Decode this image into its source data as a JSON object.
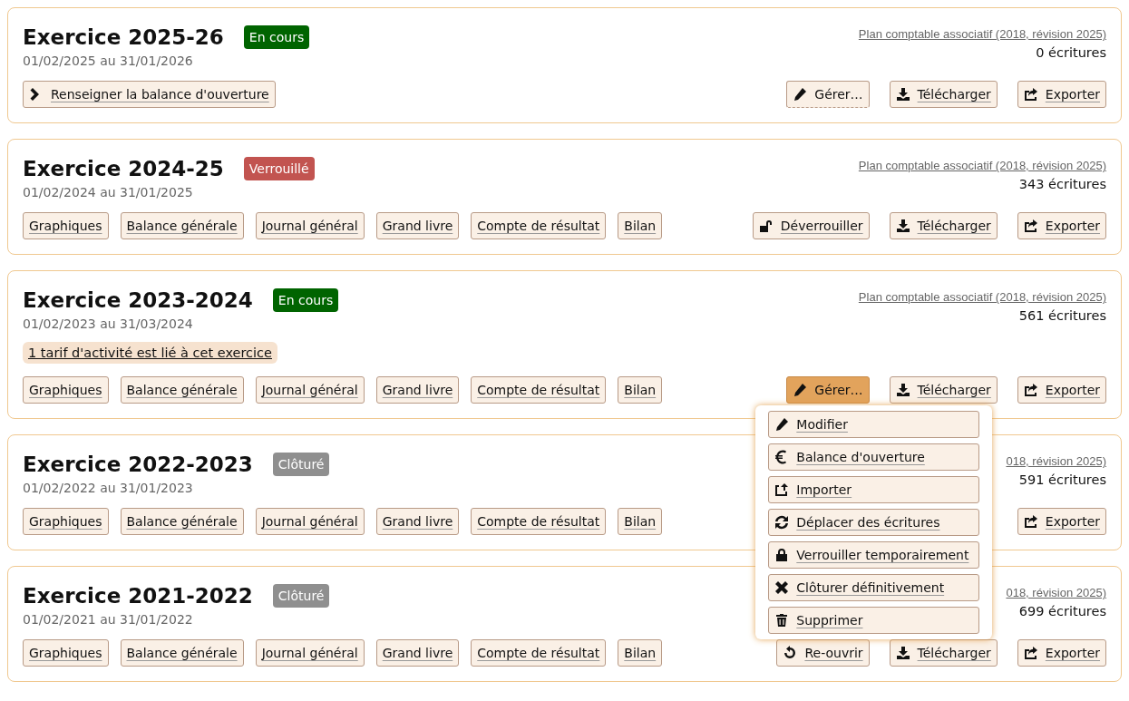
{
  "exercises": [
    {
      "title": "Exercice 2025-26",
      "status": {
        "label": "En cours",
        "kind": "open"
      },
      "dates": "01/02/2025 au 31/01/2026",
      "chart_of_accounts": "Plan comptable associatif (2018, révision 2025)",
      "entries": "0 écritures",
      "links": [
        {
          "label": "Renseigner la balance d'ouverture",
          "kind": "next"
        }
      ],
      "actions": [
        {
          "label": "Gérer…",
          "kind": "manage",
          "expanded": false
        },
        {
          "label": "Télécharger",
          "kind": "download"
        },
        {
          "label": "Exporter",
          "kind": "export"
        }
      ]
    },
    {
      "title": "Exercice 2024-25",
      "status": {
        "label": "Verrouillé",
        "kind": "locked"
      },
      "dates": "01/02/2024 au 31/01/2025",
      "chart_of_accounts": "Plan comptable associatif (2018, révision 2025)",
      "entries": "343 écritures",
      "links": [
        {
          "label": "Graphiques",
          "kind": "plain"
        },
        {
          "label": "Balance générale",
          "kind": "plain"
        },
        {
          "label": "Journal général",
          "kind": "plain"
        },
        {
          "label": "Grand livre",
          "kind": "plain"
        },
        {
          "label": "Compte de résultat",
          "kind": "plain"
        },
        {
          "label": "Bilan",
          "kind": "plain"
        }
      ],
      "actions": [
        {
          "label": "Déverrouiller",
          "kind": "unlock"
        },
        {
          "label": "Télécharger",
          "kind": "download"
        },
        {
          "label": "Exporter",
          "kind": "export"
        }
      ]
    },
    {
      "title": "Exercice 2023-2024",
      "status": {
        "label": "En cours",
        "kind": "open"
      },
      "dates": "01/02/2023 au 31/03/2024",
      "chart_of_accounts": "Plan comptable associatif (2018, révision 2025)",
      "entries": "561 écritures",
      "notice": "1 tarif d'activité est lié à cet exercice",
      "links": [
        {
          "label": "Graphiques",
          "kind": "plain"
        },
        {
          "label": "Balance générale",
          "kind": "plain"
        },
        {
          "label": "Journal général",
          "kind": "plain"
        },
        {
          "label": "Grand livre",
          "kind": "plain"
        },
        {
          "label": "Compte de résultat",
          "kind": "plain"
        },
        {
          "label": "Bilan",
          "kind": "plain"
        }
      ],
      "actions": [
        {
          "label": "Gérer…",
          "kind": "manage",
          "expanded": true,
          "menu": [
            {
              "label": "Modifier",
              "kind": "edit"
            },
            {
              "label": "Balance d'ouverture",
              "kind": "euro"
            },
            {
              "label": "Importer",
              "kind": "import"
            },
            {
              "label": "Déplacer des écritures",
              "kind": "move"
            },
            {
              "label": "Verrouiller temporairement",
              "kind": "lock"
            },
            {
              "label": "Clôturer définitivement",
              "kind": "close"
            },
            {
              "label": "Supprimer",
              "kind": "delete"
            }
          ]
        },
        {
          "label": "Télécharger",
          "kind": "download"
        },
        {
          "label": "Exporter",
          "kind": "export"
        }
      ]
    },
    {
      "title": "Exercice 2022-2023",
      "status": {
        "label": "Clôturé",
        "kind": "closed"
      },
      "dates": "01/02/2022 au 31/01/2023",
      "chart_of_accounts": "018, révision 2025)",
      "entries": "591 écritures",
      "links": [
        {
          "label": "Graphiques",
          "kind": "plain"
        },
        {
          "label": "Balance générale",
          "kind": "plain"
        },
        {
          "label": "Journal général",
          "kind": "plain"
        },
        {
          "label": "Grand livre",
          "kind": "plain"
        },
        {
          "label": "Compte de résultat",
          "kind": "plain"
        },
        {
          "label": "Bilan",
          "kind": "plain"
        }
      ],
      "actions": [
        {
          "label": "Exporter",
          "kind": "export"
        }
      ]
    },
    {
      "title": "Exercice 2021-2022",
      "status": {
        "label": "Clôturé",
        "kind": "closed"
      },
      "dates": "01/02/2021 au 31/01/2022",
      "chart_of_accounts": "018, révision 2025)",
      "entries": "699 écritures",
      "links": [
        {
          "label": "Graphiques",
          "kind": "plain"
        },
        {
          "label": "Balance générale",
          "kind": "plain"
        },
        {
          "label": "Journal général",
          "kind": "plain"
        },
        {
          "label": "Grand livre",
          "kind": "plain"
        },
        {
          "label": "Compte de résultat",
          "kind": "plain"
        },
        {
          "label": "Bilan",
          "kind": "plain"
        }
      ],
      "actions": [
        {
          "label": "Re-ouvrir",
          "kind": "reopen"
        },
        {
          "label": "Télécharger",
          "kind": "download"
        },
        {
          "label": "Exporter",
          "kind": "export"
        }
      ]
    }
  ]
}
